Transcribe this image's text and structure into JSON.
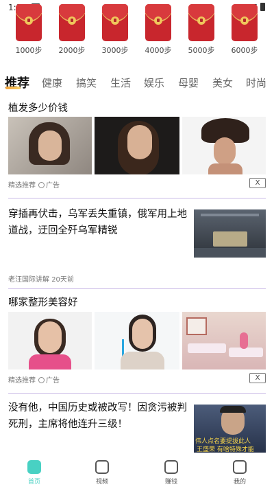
{
  "status_bar": {
    "time": "1:39"
  },
  "envelopes": [
    {
      "label": "1000步"
    },
    {
      "label": "2000步"
    },
    {
      "label": "3000步"
    },
    {
      "label": "4000步"
    },
    {
      "label": "5000步"
    },
    {
      "label": "6000步"
    }
  ],
  "tabs": [
    "推荐",
    "健康",
    "搞笑",
    "生活",
    "娱乐",
    "母婴",
    "美女",
    "时尚"
  ],
  "feed": {
    "item1": {
      "title": "植发多少价钱",
      "source": "精选推荐",
      "ad": "广告",
      "close": "X"
    },
    "item2": {
      "title": "穿插再伏击，乌军丢失重镇，俄军用上地道战，迂回全歼乌军精锐",
      "source": "老汪国际讲解",
      "time": "20天前"
    },
    "item3": {
      "title": "哪家整形美容好",
      "source": "精选推荐",
      "ad": "广告",
      "close": "X"
    },
    "item4": {
      "title": "没有他，中国历史或被改写！因贪污被判死刑，主席将他连升三级！",
      "thumb_caption1": "伟人点名要提拔此人",
      "thumb_caption2": "王盛荣 有啥特殊才能"
    }
  },
  "bottom_nav": [
    {
      "label": "首页",
      "icon": "home-icon",
      "active": true
    },
    {
      "label": "视频",
      "icon": "video-icon",
      "active": false
    },
    {
      "label": "赚钱",
      "icon": "wallet-icon",
      "active": false
    },
    {
      "label": "我的",
      "icon": "profile-icon",
      "active": false
    }
  ],
  "colors": {
    "accent": "#48d1c3",
    "envelope_red": "#c8262d",
    "divider": "#c9b9e6",
    "tab_underline": "#f3a43c"
  }
}
